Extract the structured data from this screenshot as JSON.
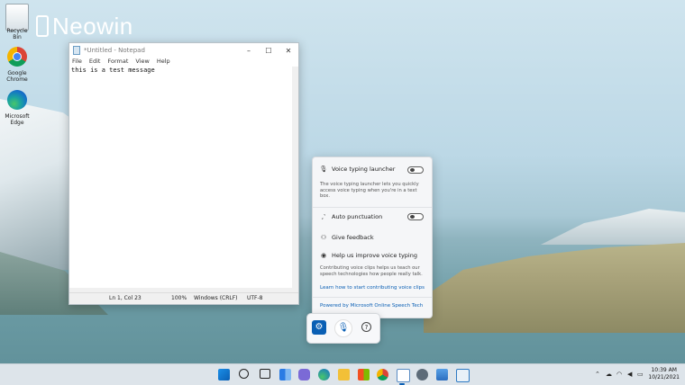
{
  "desktop": {
    "watermark": "Neowin",
    "icons": [
      {
        "label": "Recycle Bin",
        "icon": "recycle-bin-icon"
      },
      {
        "label": "Google Chrome",
        "icon": "chrome-icon"
      },
      {
        "label": "Microsoft Edge",
        "icon": "edge-icon"
      }
    ]
  },
  "notepad": {
    "title": "*Untitled - Notepad",
    "window_controls": [
      "minimize",
      "maximize",
      "close"
    ],
    "menu": [
      "File",
      "Edit",
      "Format",
      "View",
      "Help"
    ],
    "content": "this is a test message",
    "status": {
      "position": "Ln 1, Col 23",
      "zoom": "100%",
      "line_ending": "Windows (CRLF)",
      "encoding": "UTF-8"
    }
  },
  "voice_settings": {
    "launcher": {
      "label": "Voice typing launcher",
      "on": false,
      "description": "The voice typing launcher lets you quickly access voice typing when you're in a text box."
    },
    "auto_punctuation": {
      "label": "Auto punctuation",
      "on": false
    },
    "feedback": {
      "label": "Give feedback"
    },
    "improve": {
      "label": "Help us improve voice typing",
      "description": "Contributing voice clips helps us teach our speech technologies how people really talk.",
      "link": "Learn how to start contributing voice clips"
    },
    "powered_by": "Powered by Microsoft Online Speech Tech"
  },
  "voice_bar": {
    "settings": "gear-icon",
    "mic": "microphone-icon",
    "help": "?"
  },
  "taskbar": {
    "apps": [
      "start",
      "search",
      "task-view",
      "widgets",
      "teams-chat",
      "edge",
      "file-explorer",
      "store",
      "chrome",
      "notepad",
      "settings",
      "photos",
      "notepad-2"
    ],
    "colors": {
      "accent": "#0a5fb4"
    },
    "clock": {
      "time": "10:39 AM",
      "date": "10/21/2021"
    }
  }
}
